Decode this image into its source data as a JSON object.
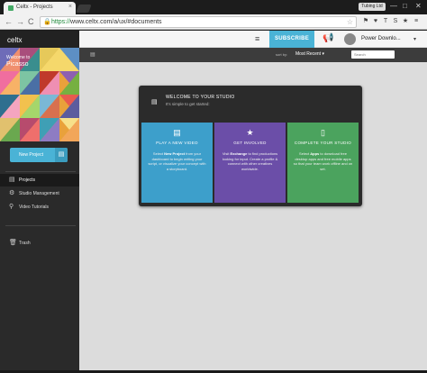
{
  "browser": {
    "tab_title": "Celtx - Projects",
    "tab_close": "×",
    "user_label": "Tubing Ltd",
    "window_controls": [
      "—",
      "□",
      "✕"
    ],
    "nav": {
      "back": "←",
      "forward": "→",
      "reload": "C"
    },
    "url_protocol": "https://",
    "url_rest": "www.celtx.com/a/ux/#documents",
    "url_lock": "🔒",
    "url_star": "☆",
    "extensions": [
      "⚑",
      "♥",
      "T",
      "S",
      "★",
      "≡"
    ]
  },
  "app": {
    "logo": "celtx",
    "welcome_line": "Welcome to",
    "welcome_name": "Picasso",
    "new_project_label": "New Project",
    "new_project_icon": "▤",
    "nav_items": [
      {
        "label": "Projects",
        "icon": "▤"
      },
      {
        "label": "Studio Management",
        "icon": "⚙"
      },
      {
        "label": "Video Tutorials",
        "icon": "⚲"
      }
    ],
    "trash_label": "Trash",
    "trash_icon": "🗑"
  },
  "topbar": {
    "menu_icon": "≡",
    "subscribe_label": "SUBSCRIBE",
    "announce_icon": "📢",
    "user_name": "Power Downlo...",
    "chevron": "▾"
  },
  "filterbar": {
    "view_icon": "▤",
    "sort_by": "sort by:",
    "sort_value": "Most Recent ▾",
    "search_placeholder": "Search"
  },
  "studio": {
    "icon": "▤",
    "title": "WELCOME TO YOUR STUDIO",
    "subtitle": "It's simple to get started:",
    "cards": [
      {
        "icon": "▤",
        "title": "PLAY A NEW VIDEO",
        "pre": "Select ",
        "bold": "New Project",
        "post": " from your dashboard to begin writing your script, or visualize your concept with a storyboard.",
        "color": "#3d9fcb"
      },
      {
        "icon": "★",
        "title": "GET INVOLVED",
        "pre": "Visit ",
        "bold": "Exchange",
        "post": " to find productions looking for input. Create a profile & connect with other creatives worldwide.",
        "color": "#6b4ea8"
      },
      {
        "icon": "▯",
        "title": "COMPLETE YOUR STUDIO",
        "pre": "Select ",
        "bold": "Apps",
        "post": " to download free desktop apps and free mobile apps so that your team work offline and on set.",
        "color": "#4ba35e"
      }
    ]
  },
  "colors": {
    "accent": "#4ab3d6",
    "sidebar": "#2a2a2a",
    "main_bg": "#dcdcdc"
  }
}
